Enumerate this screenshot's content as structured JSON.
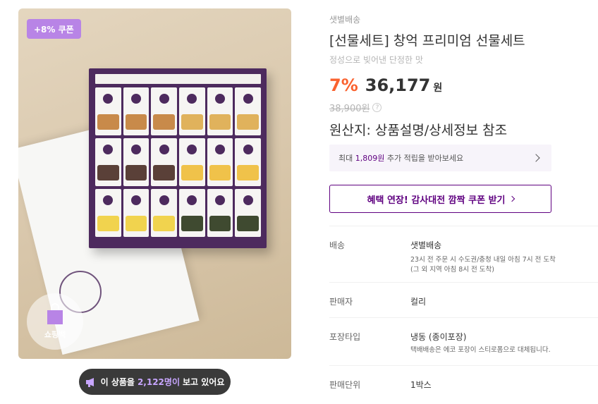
{
  "image": {
    "coupon_badge": "+8% 쿠폰",
    "shopping_bag_label": "쇼핑백"
  },
  "viewers": {
    "prefix": "이 상품을",
    "count": "2,122명이",
    "suffix": "보고 있어요"
  },
  "product": {
    "delivery_tag": "샛별배송",
    "title": "[선물세트] 창억 프리미엄 선물세트",
    "subtitle": "정성으로 빚어낸 단정한 맛",
    "discount": "7%",
    "price": "36,177",
    "currency": "원",
    "original_price": "38,900원",
    "origin": "원산지: 상품설명/상세정보 참조"
  },
  "reward": {
    "prefix": "최대",
    "amount": "1,809원",
    "suffix": "추가 적립을 받아보세요"
  },
  "coupon_button": {
    "label": "혜택 연장! 감사대전 깜짝 쿠폰 받기"
  },
  "specs": [
    {
      "key": "배송",
      "value": "샛별배송",
      "notes": [
        "23시 전 주문 시 수도권/충청 내일 아침 7시 전 도착",
        "(그 외 지역 아침 8시 전 도착)"
      ]
    },
    {
      "key": "판매자",
      "value": "컬리",
      "notes": []
    },
    {
      "key": "포장타입",
      "value": "냉동 (종이포장)",
      "notes": [
        "택배배송은 에코 포장이 스티로폼으로 대체됩니다."
      ]
    },
    {
      "key": "판매단위",
      "value": "1박스",
      "notes": []
    }
  ],
  "colors": {
    "accent_purple": "#5f0080",
    "discount_orange": "#fa622f",
    "coupon_badge": "#b884e6",
    "box_purple": "#4d2a5e"
  }
}
